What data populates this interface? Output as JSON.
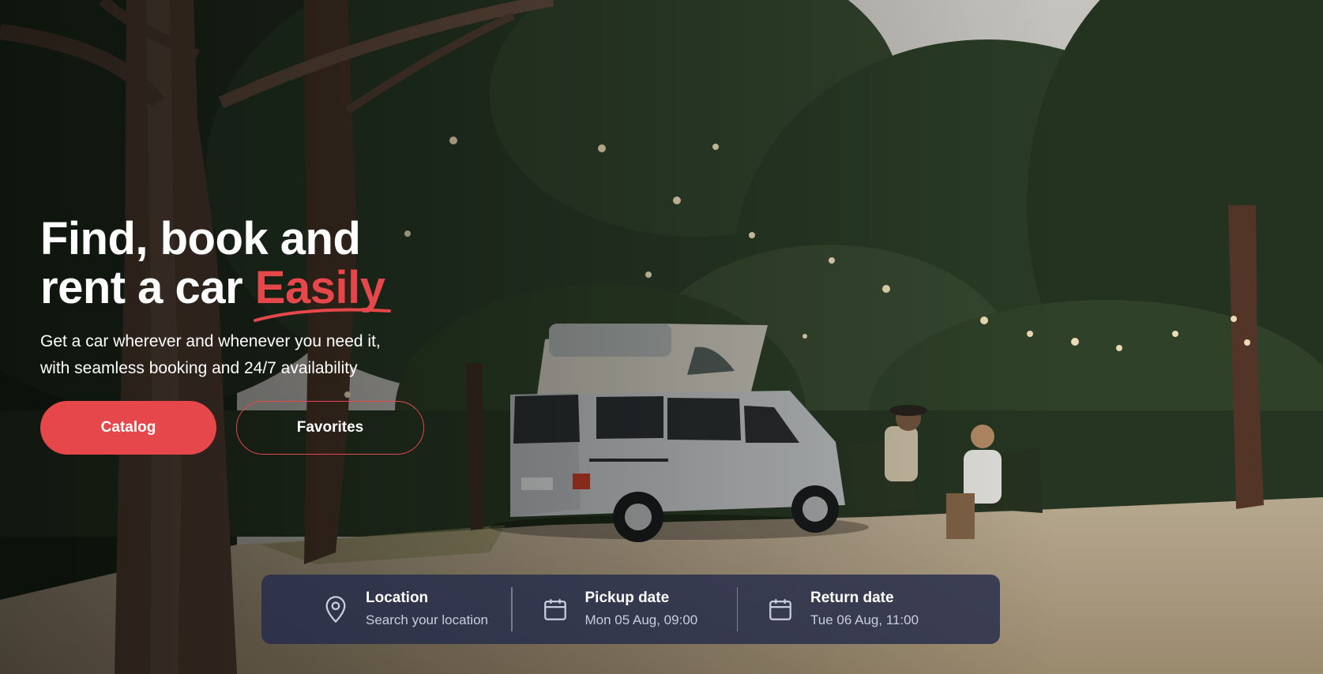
{
  "hero": {
    "title_line1": "Find, book and",
    "title_line2": "rent a car",
    "title_accent": "Easily",
    "subtitle_line1": "Get a car wherever and whenever you need it,",
    "subtitle_line2": "with seamless booking and 24/7 availability"
  },
  "buttons": {
    "catalog": "Catalog",
    "favorites": "Favorites"
  },
  "search": {
    "location": {
      "label": "Location",
      "value": "Search your location",
      "icon": "map-pin-icon"
    },
    "pickup": {
      "label": "Pickup date",
      "value": "Mon 05 Aug, 09:00",
      "icon": "calendar-icon"
    },
    "return": {
      "label": "Return date",
      "value": "Tue 06 Aug, 11:00",
      "icon": "calendar-icon"
    }
  },
  "colors": {
    "accent": "#e5474b",
    "search_bar_bg": "#242c4a",
    "text": "#ffffff"
  }
}
